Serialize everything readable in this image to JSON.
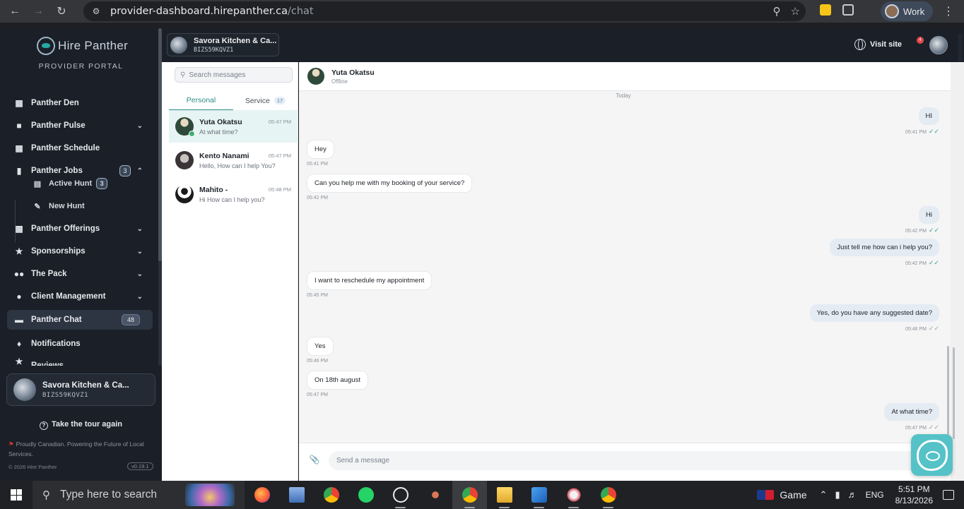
{
  "browser": {
    "url_host": "provider-dashboard.hirepanther.ca",
    "url_path": "/chat",
    "profile_label": "Work"
  },
  "sidebar": {
    "brand_name": "Hire Panther",
    "brand_subtitle": "PROVIDER PORTAL",
    "items": [
      {
        "label": "Panther Den",
        "icon": "dashboard-icon"
      },
      {
        "label": "Panther Pulse",
        "icon": "pulse-icon"
      },
      {
        "label": "Panther Schedule",
        "icon": "calendar-icon"
      },
      {
        "label": "Panther Jobs",
        "icon": "bookmark-icon",
        "badge": "3"
      },
      {
        "label": "Panther Offerings",
        "icon": "briefcase-icon"
      },
      {
        "label": "Sponsorships",
        "icon": "star-icon"
      },
      {
        "label": "The Pack",
        "icon": "group-icon"
      },
      {
        "label": "Client Management",
        "icon": "user-icon"
      },
      {
        "label": "Panther Chat",
        "icon": "chat-icon",
        "badge": "48"
      },
      {
        "label": "Notifications",
        "icon": "bell-icon"
      },
      {
        "label": "Reviews",
        "icon": "review-icon"
      }
    ],
    "sub_items": [
      {
        "label": "Active Hunt",
        "badge": "3"
      },
      {
        "label": "New Hunt"
      }
    ],
    "business_name": "Savora Kitchen & Ca...",
    "business_id": "BIZS59KQVZ1",
    "tour_label": "Take the tour again",
    "tagline": "Proudly Canadian. Powering the Future of Local Services.",
    "copyright": "© 2026 Hire Panther",
    "version": "v0.19.1"
  },
  "topbar": {
    "business_name": "Savora Kitchen & Ca...",
    "business_id": "BIZS59KQVZ1",
    "visit_site": "Visit site",
    "notif_count": "4"
  },
  "conversations": {
    "search_placeholder": "Search messages",
    "tabs": [
      {
        "label": "Personal"
      },
      {
        "label": "Service",
        "count": "17"
      }
    ],
    "items": [
      {
        "name": "Yuta Okatsu",
        "last": "At what time?",
        "time": "05:47 PM"
      },
      {
        "name": "Kento Nanami",
        "last": "Hello, How can I help You?",
        "time": "05:47 PM"
      },
      {
        "name": "Mahito -",
        "last": "Hi How can I help you?",
        "time": "05:48 PM"
      }
    ]
  },
  "chat": {
    "contact_name": "Yuta Okatsu",
    "contact_status": "Offline",
    "day_label": "Today",
    "messages": [
      {
        "dir": "out",
        "text": "HI",
        "time": "05:41 PM"
      },
      {
        "dir": "in",
        "text": "Hey",
        "time": "05:41 PM"
      },
      {
        "dir": "in",
        "text": "Can you help me with my booking of your service?",
        "time": "05:42 PM"
      },
      {
        "dir": "out",
        "text": "Hi",
        "time": "05:42 PM"
      },
      {
        "dir": "out",
        "text": "Just tell me how can i help you?",
        "time": "05:42 PM"
      },
      {
        "dir": "in",
        "text": "I want to reschedule my appointment",
        "time": "05:45 PM"
      },
      {
        "dir": "out",
        "text": "Yes, do you have any suggested date?",
        "time": "05:46 PM"
      },
      {
        "dir": "in",
        "text": "Yes",
        "time": "05:46 PM"
      },
      {
        "dir": "in",
        "text": "On 18th august",
        "time": "05:47 PM"
      },
      {
        "dir": "out",
        "text": "At what time?",
        "time": "05:47 PM"
      }
    ],
    "composer_placeholder": "Send a message"
  },
  "taskbar": {
    "search_placeholder": "Type here to search",
    "game_label": "Game",
    "language": "ENG",
    "time": "5:51 PM",
    "date": "8/13/2026"
  }
}
